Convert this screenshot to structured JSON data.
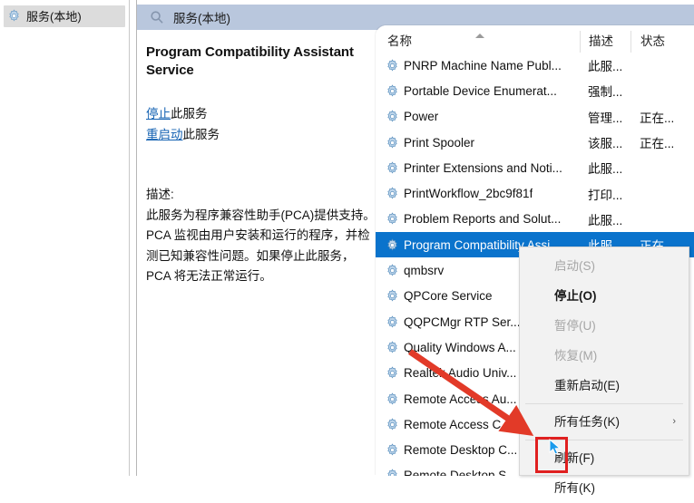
{
  "tree": {
    "node_label": "服务(本地)",
    "node_icon": "gear-icon"
  },
  "console": {
    "header_title": "服务(本地)",
    "header_icon": "search-icon"
  },
  "detail": {
    "service_title": "Program Compatibility Assistant Service",
    "stop_link": "停止",
    "stop_suffix": "此服务",
    "restart_link": "重启动",
    "restart_suffix": "此服务",
    "description_label": "描述:",
    "description_text": "此服务为程序兼容性助手(PCA)提供支持。PCA 监视由用户安装和运行的程序，并检测已知兼容性问题。如果停止此服务，PCA 将无法正常运行。"
  },
  "list": {
    "columns": [
      "名称",
      "描述",
      "状态"
    ],
    "sort_indicator": "ascending",
    "rows": [
      {
        "name": "PNRP Machine Name Publ...",
        "desc": "此服...",
        "state": "",
        "selected": false
      },
      {
        "name": "Portable Device Enumerat...",
        "desc": "强制...",
        "state": "",
        "selected": false
      },
      {
        "name": "Power",
        "desc": "管理...",
        "state": "正在...",
        "selected": false
      },
      {
        "name": "Print Spooler",
        "desc": "该服...",
        "state": "正在...",
        "selected": false
      },
      {
        "name": "Printer Extensions and Noti...",
        "desc": "此服...",
        "state": "",
        "selected": false
      },
      {
        "name": "PrintWorkflow_2bc9f81f",
        "desc": "打印...",
        "state": "",
        "selected": false
      },
      {
        "name": "Problem Reports and Solut...",
        "desc": "此服...",
        "state": "",
        "selected": false
      },
      {
        "name": "Program Compatibility Assi...",
        "desc": "此服...",
        "state": "正在...",
        "selected": true
      },
      {
        "name": "qmbsrv",
        "desc": "",
        "state": "",
        "selected": false
      },
      {
        "name": "QPCore Service",
        "desc": "",
        "state": "",
        "selected": false
      },
      {
        "name": "QQPCMgr RTP Ser...",
        "desc": "",
        "state": "",
        "selected": false
      },
      {
        "name": "Quality Windows A...",
        "desc": "",
        "state": "",
        "selected": false
      },
      {
        "name": "Realtek Audio Univ...",
        "desc": "",
        "state": "",
        "selected": false
      },
      {
        "name": "Remote Access Au...",
        "desc": "",
        "state": "",
        "selected": false
      },
      {
        "name": "Remote Access C...",
        "desc": "",
        "state": "",
        "selected": false
      },
      {
        "name": "Remote Desktop C...",
        "desc": "",
        "state": "",
        "selected": false
      },
      {
        "name": "Remote Desktop S...",
        "desc": "",
        "state": "",
        "selected": false
      }
    ]
  },
  "context_menu": {
    "items": [
      {
        "label": "启动(S)",
        "disabled": true,
        "submenu": false,
        "bold": false,
        "separator_after": false
      },
      {
        "label": "停止(O)",
        "disabled": false,
        "submenu": false,
        "bold": true,
        "separator_after": false
      },
      {
        "label": "暂停(U)",
        "disabled": true,
        "submenu": false,
        "bold": false,
        "separator_after": false
      },
      {
        "label": "恢复(M)",
        "disabled": true,
        "submenu": false,
        "bold": false,
        "separator_after": false
      },
      {
        "label": "重新启动(E)",
        "disabled": false,
        "submenu": false,
        "bold": false,
        "separator_after": true
      },
      {
        "label": "所有任务(K)",
        "disabled": false,
        "submenu": true,
        "bold": false,
        "separator_after": true
      },
      {
        "label": "刷新(F)",
        "disabled": false,
        "submenu": false,
        "bold": false,
        "separator_after": false
      },
      {
        "label": "所有(K)",
        "disabled": false,
        "submenu": false,
        "bold": false,
        "separator_after": false
      }
    ],
    "submenu_glyph": "›"
  },
  "annotations": {
    "arrow_color": "#e23a28",
    "highlight_box_color": "#e02020",
    "cursor_color": "#1a9bec"
  },
  "colors": {
    "selection_blue": "#0a73cc",
    "header_blue": "#b9c7dd",
    "link_blue": "#1663b3",
    "menu_bg": "#f2f2f2"
  }
}
